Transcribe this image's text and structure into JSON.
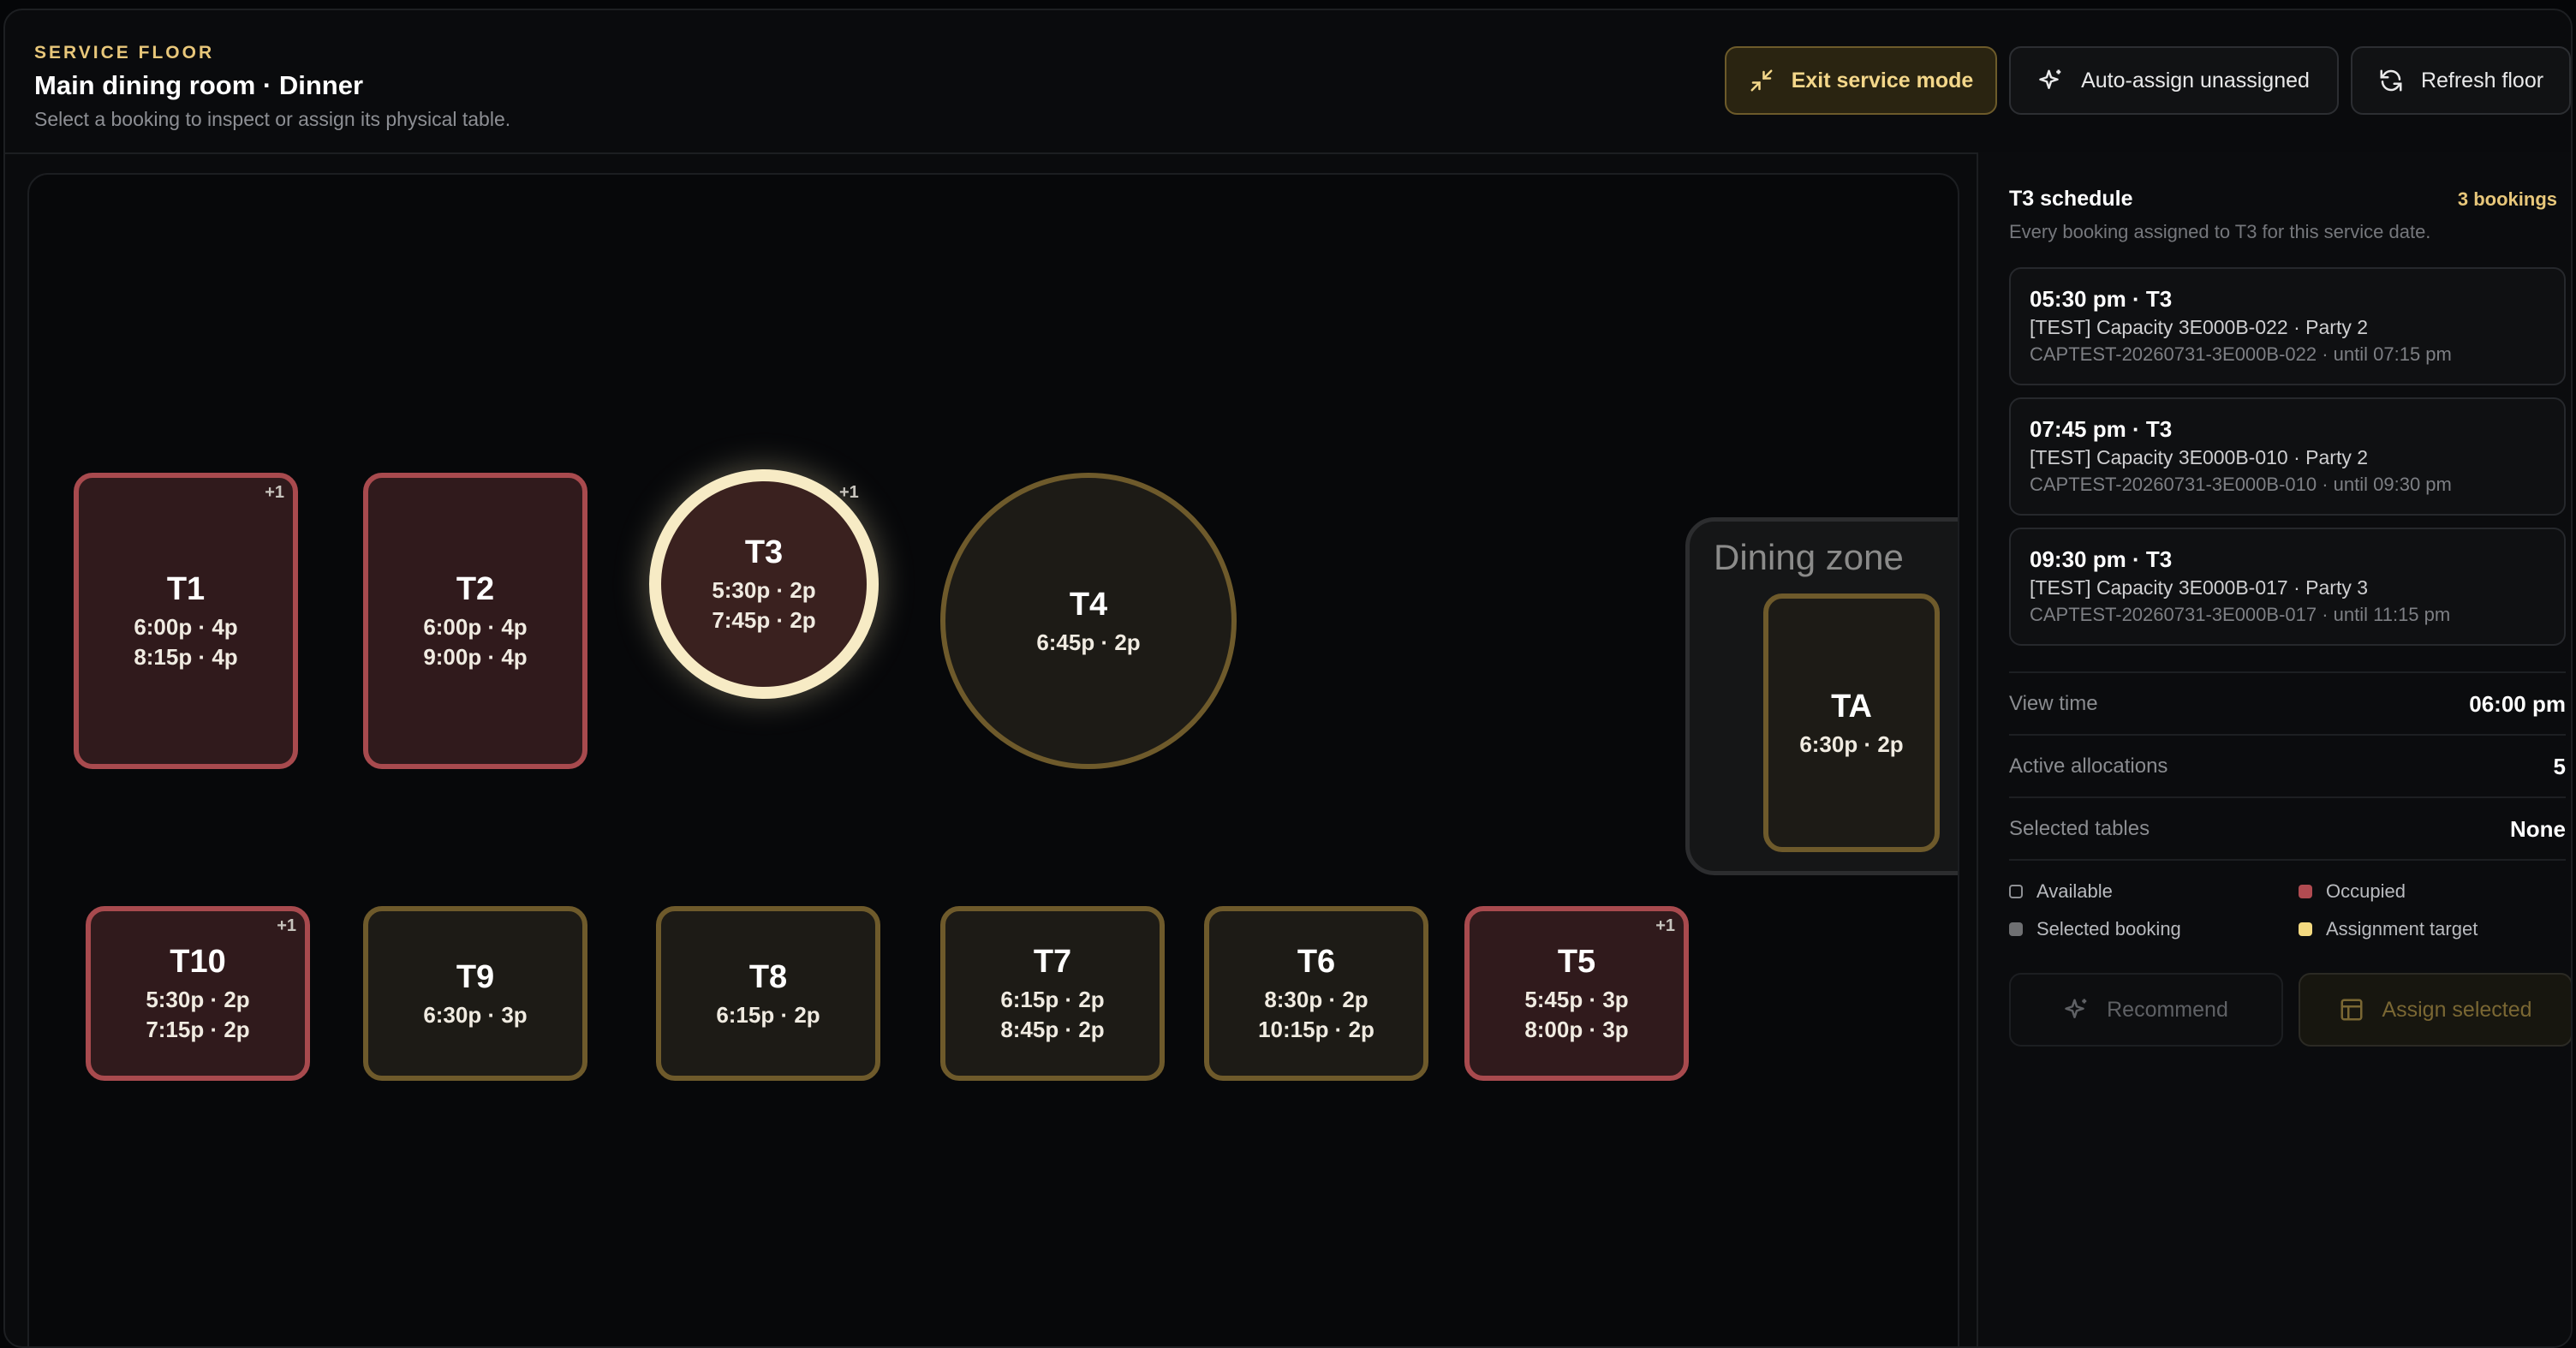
{
  "header": {
    "eyebrow": "SERVICE FLOOR",
    "title": "Main dining room · Dinner",
    "subtitle": "Select a booking to inspect or assign its physical table.",
    "buttons": {
      "exit": "Exit service mode",
      "auto_assign": "Auto-assign unassigned",
      "refresh": "Refresh floor"
    }
  },
  "floor": {
    "tables": [
      {
        "id": "T1",
        "status": "occupied",
        "shape": "rect",
        "slots": [
          "6:00p · 4p",
          "8:15p · 4p"
        ],
        "badge": "+1"
      },
      {
        "id": "T2",
        "status": "occupied",
        "shape": "rect",
        "slots": [
          "6:00p · 4p",
          "9:00p · 4p"
        ]
      },
      {
        "id": "T3",
        "status": "selected",
        "shape": "round",
        "slots": [
          "5:30p · 2p",
          "7:45p · 2p"
        ],
        "badge": "+1"
      },
      {
        "id": "T4",
        "status": "available",
        "shape": "round",
        "slots": [
          "6:45p · 2p"
        ]
      },
      {
        "id": "T10",
        "status": "occupied",
        "shape": "rect",
        "slots": [
          "5:30p · 2p",
          "7:15p · 2p"
        ],
        "badge": "+1"
      },
      {
        "id": "T9",
        "status": "available",
        "shape": "rect",
        "slots": [
          "6:30p · 3p"
        ]
      },
      {
        "id": "T8",
        "status": "available",
        "shape": "rect",
        "slots": [
          "6:15p · 2p"
        ]
      },
      {
        "id": "T7",
        "status": "available",
        "shape": "rect",
        "slots": [
          "6:15p · 2p",
          "8:45p · 2p"
        ]
      },
      {
        "id": "T6",
        "status": "available",
        "shape": "rect",
        "slots": [
          "8:30p · 2p",
          "10:15p · 2p"
        ]
      },
      {
        "id": "T5",
        "status": "occupied",
        "shape": "rect",
        "slots": [
          "5:45p · 3p",
          "8:00p · 3p"
        ],
        "badge": "+1"
      },
      {
        "id": "TA",
        "status": "available",
        "shape": "rect",
        "slots": [
          "6:30p · 2p"
        ]
      }
    ],
    "zone_label": "Dining zone"
  },
  "sidebar": {
    "title": "T3 schedule",
    "count": "3 bookings",
    "description": "Every booking assigned to T3 for this service date.",
    "bookings": [
      {
        "time": "05:30 pm · T3",
        "name": "[TEST] Capacity 3E000B-022 · Party 2",
        "code": "CAPTEST-20260731-3E000B-022 · until 07:15 pm"
      },
      {
        "time": "07:45 pm · T3",
        "name": "[TEST] Capacity 3E000B-010 · Party 2",
        "code": "CAPTEST-20260731-3E000B-010 · until 09:30 pm"
      },
      {
        "time": "09:30 pm · T3",
        "name": "[TEST] Capacity 3E000B-017 · Party 3",
        "code": "CAPTEST-20260731-3E000B-017 · until 11:15 pm"
      }
    ],
    "stats": [
      {
        "label": "View time",
        "value": "06:00 pm"
      },
      {
        "label": "Active allocations",
        "value": "5"
      },
      {
        "label": "Selected tables",
        "value": "None"
      }
    ],
    "legend": {
      "available": "Available",
      "occupied": "Occupied",
      "selected": "Selected booking",
      "target": "Assignment target"
    },
    "actions": {
      "recommend": "Recommend",
      "assign": "Assign selected"
    }
  },
  "colors": {
    "accent": "#e8c77a",
    "occupied": "#a84a4e",
    "available": "#6e5a2b",
    "selected": "#f7ebc5"
  }
}
